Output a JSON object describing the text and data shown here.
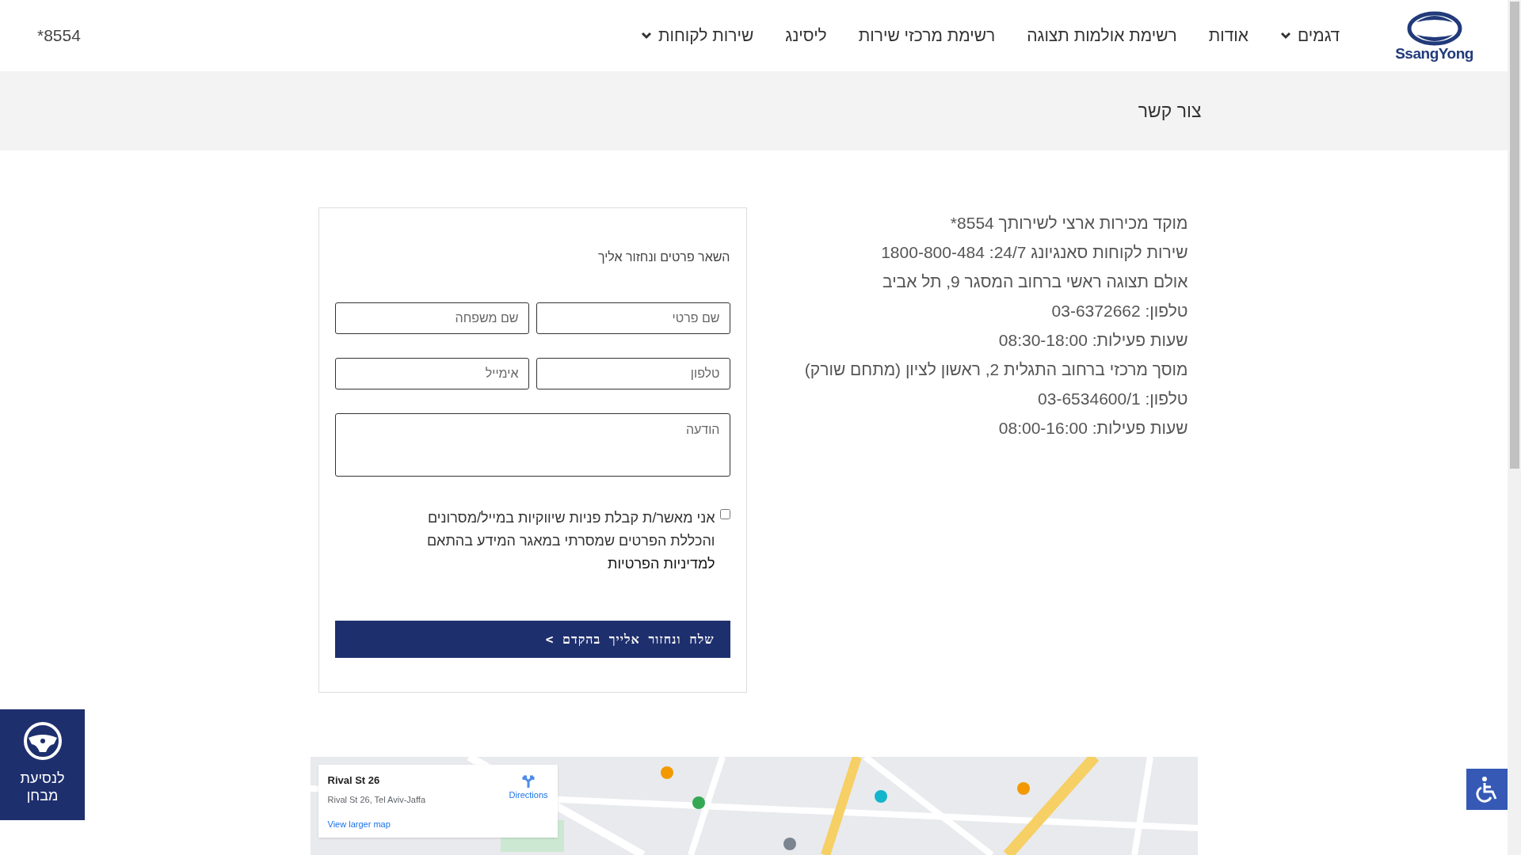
{
  "header": {
    "logo_text": "SsangYong",
    "nav": [
      {
        "label": "דגמים",
        "has_dropdown": true
      },
      {
        "label": "אודות",
        "has_dropdown": false
      },
      {
        "label": "רשימת אולמות תצוגה",
        "has_dropdown": false
      },
      {
        "label": "רשימת מרכזי שירות",
        "has_dropdown": false
      },
      {
        "label": "ליסינג",
        "has_dropdown": false
      },
      {
        "label": "שירות לקוחות",
        "has_dropdown": true
      }
    ],
    "phone": "*8554"
  },
  "page_title": "צור קשר",
  "contact_info": [
    "מוקד מכירות ארצי לשירותך 8554*",
    "שירות לקוחות סאנגיונג 24/7: 1800-800-484",
    "אולם תצוגה ראשי ברחוב המסגר 9, תל אביב",
    "טלפון: 03-6372662",
    "שעות פעילות: 08:30-18:00",
    "מוסך מרכזי ברחוב התגלית 2, ראשון לציון (מתחם שורק)",
    "טלפון: 03-6534600/1",
    "שעות פעילות: 08:00-16:00"
  ],
  "form": {
    "intro": "השאר פרטים ונחזור אליך",
    "fields": [
      {
        "placeholder": "שם פרטי"
      },
      {
        "placeholder": "שם משפחה"
      },
      {
        "placeholder": "טלפון"
      },
      {
        "placeholder": "אימייל"
      }
    ],
    "message": {
      "placeholder": "הודעה"
    },
    "consent": {
      "checked": false,
      "text": "אני מאשר/ת קבלת פניות שיווקיות במייל/מסרונים והכללת הפרטים שמסרתי במאגר המידע בהתאם",
      "link": "למדיניות הפרטיות"
    },
    "submit": "שלח ונחזור אלייך בהקדם >"
  },
  "map": {
    "card": {
      "title": "Rival St 26",
      "address": "Rival St 26, Tel Aviv-Jaffa",
      "directions": "Directions",
      "larger_map": "View larger map"
    }
  },
  "test_drive": {
    "label": "לנסיעת מבחן"
  }
}
